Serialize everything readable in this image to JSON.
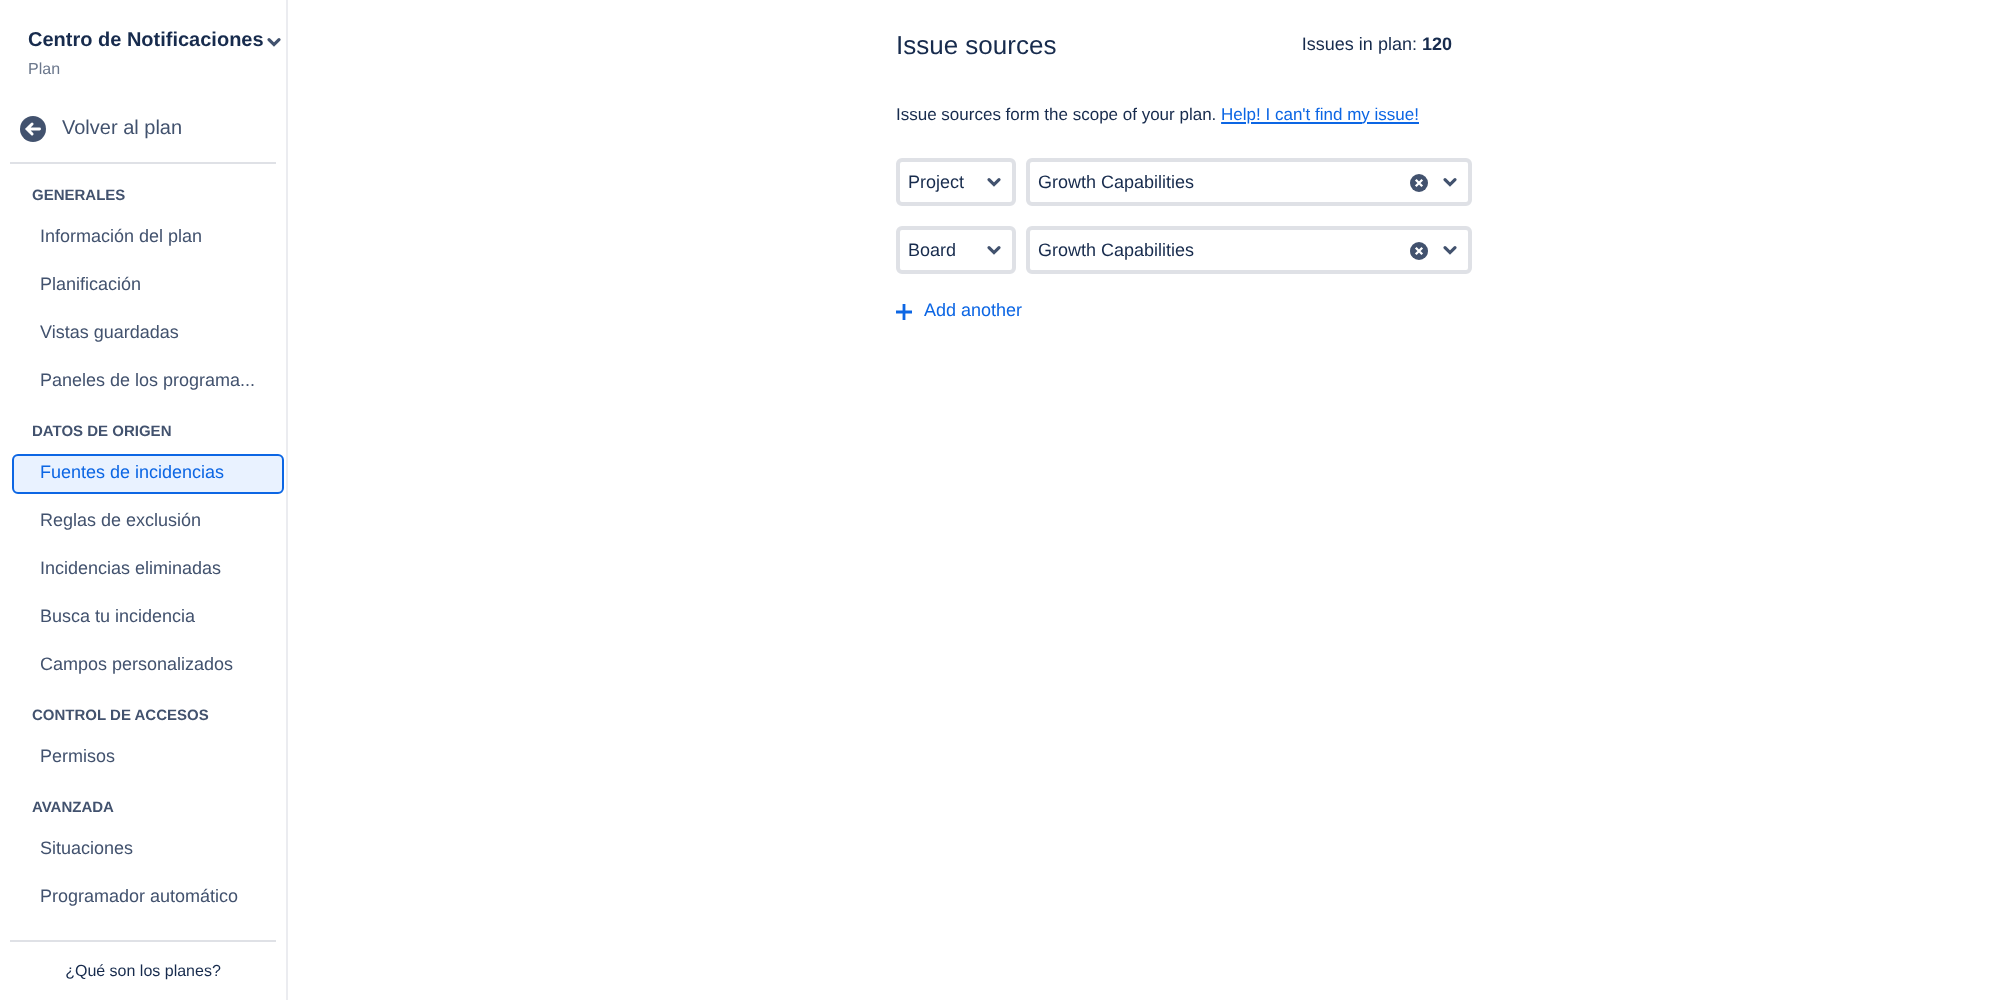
{
  "sidebar": {
    "project": {
      "title": "Centro de Notificaciones",
      "subtitle": "Plan"
    },
    "back_link": "Volver al plan",
    "sections": [
      {
        "heading": "GENERALES",
        "items": [
          {
            "label": "Información del plan",
            "selected": false
          },
          {
            "label": "Planificación",
            "selected": false
          },
          {
            "label": "Vistas guardadas",
            "selected": false
          },
          {
            "label": "Paneles de los programa...",
            "selected": false
          }
        ]
      },
      {
        "heading": "DATOS DE ORIGEN",
        "items": [
          {
            "label": "Fuentes de incidencias",
            "selected": true
          },
          {
            "label": "Reglas de exclusión",
            "selected": false
          },
          {
            "label": "Incidencias eliminadas",
            "selected": false
          },
          {
            "label": "Busca tu incidencia",
            "selected": false
          },
          {
            "label": "Campos personalizados",
            "selected": false
          }
        ]
      },
      {
        "heading": "CONTROL DE ACCESOS",
        "items": [
          {
            "label": "Permisos",
            "selected": false
          }
        ]
      },
      {
        "heading": "AVANZADA",
        "items": [
          {
            "label": "Situaciones",
            "selected": false
          },
          {
            "label": "Programador automático",
            "selected": false
          }
        ]
      }
    ],
    "footer_link": "¿Qué son los planes?"
  },
  "main": {
    "title": "Issue sources",
    "issue_count": "Issues in plan: **120**",
    "description": "Issue sources form the scope of your plan.",
    "help_link": "Help! I can't find my issue!",
    "sources": [
      {
        "type": "Project",
        "value": "Growth Capabilities"
      },
      {
        "type": "Board",
        "value": "Growth Capabilities"
      }
    ],
    "add_button": "Add another"
  }
}
